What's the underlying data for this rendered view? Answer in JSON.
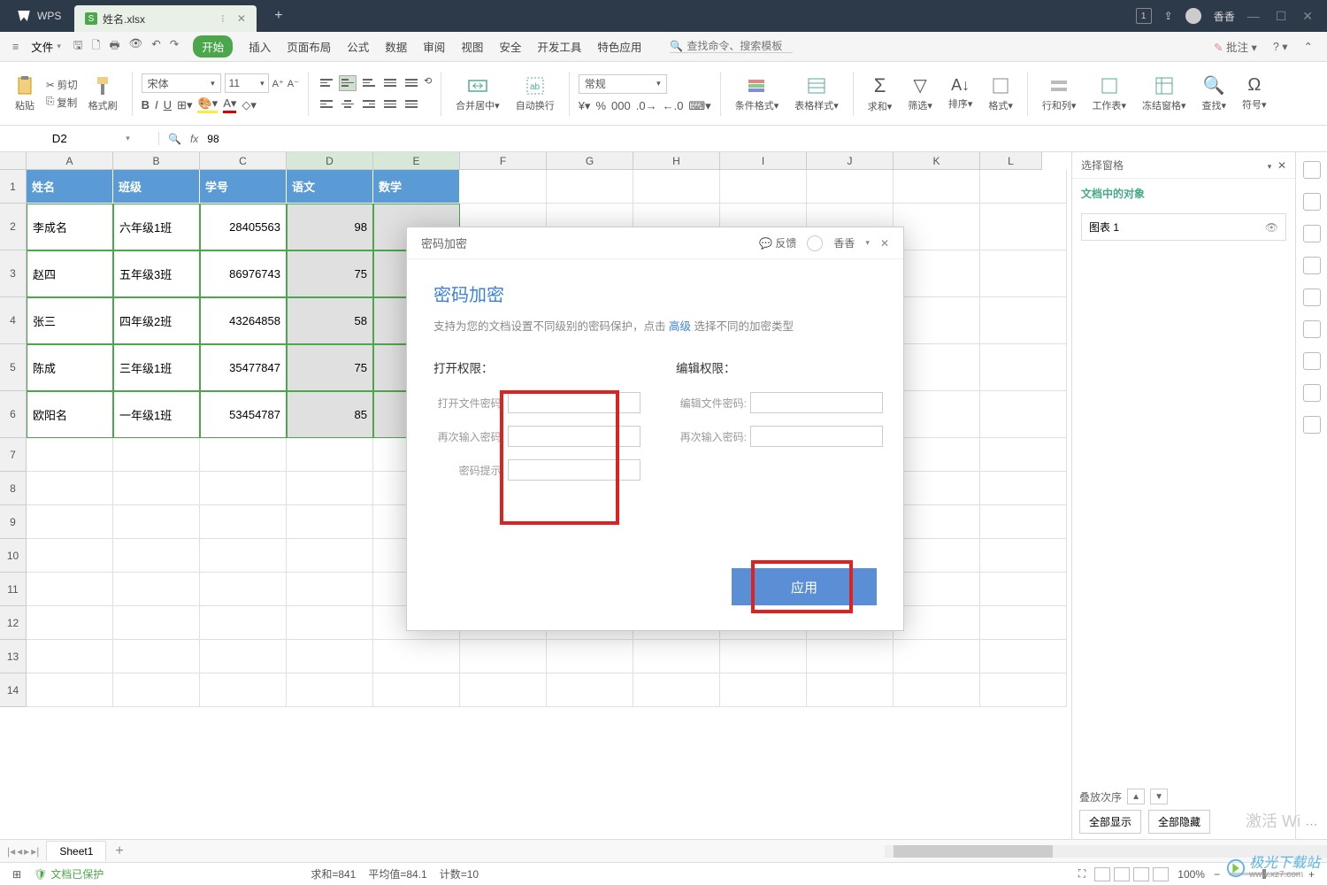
{
  "titlebar": {
    "app": "WPS",
    "filename": "姓名.xlsx",
    "user": "香香"
  },
  "menu": {
    "file": "文件",
    "tabs": [
      "开始",
      "插入",
      "页面布局",
      "公式",
      "数据",
      "审阅",
      "视图",
      "安全",
      "开发工具",
      "特色应用"
    ],
    "search_ph": "查找命令、搜索模板",
    "annotate": "批注"
  },
  "ribbon": {
    "paste": "粘贴",
    "cut": "剪切",
    "copy": "复制",
    "formatbrush": "格式刷",
    "font": "宋体",
    "size": "11",
    "merge": "合并居中",
    "wrap": "自动换行",
    "numfmt": "常规",
    "condfmt": "条件格式",
    "tablestyle": "表格样式",
    "sum": "求和",
    "filter": "筛选",
    "sort": "排序",
    "format": "格式",
    "rowcol": "行和列",
    "sheet": "工作表",
    "freeze": "冻结窗格",
    "find": "查找",
    "symbol": "符号"
  },
  "formula": {
    "cell": "D2",
    "value": "98"
  },
  "columns": [
    "A",
    "B",
    "C",
    "D",
    "E",
    "F",
    "G",
    "H",
    "I",
    "J",
    "K",
    "L"
  ],
  "table": {
    "headers": [
      "姓名",
      "班级",
      "学号",
      "语文",
      "数学"
    ],
    "rows": [
      [
        "李成名",
        "六年级1班",
        "28405563",
        "98",
        ""
      ],
      [
        "赵四",
        "五年级3班",
        "86976743",
        "75",
        ""
      ],
      [
        "张三",
        "四年级2班",
        "43264858",
        "58",
        ""
      ],
      [
        "陈成",
        "三年级1班",
        "35477847",
        "75",
        ""
      ],
      [
        "欧阳名",
        "一年级1班",
        "53454787",
        "85",
        ""
      ]
    ]
  },
  "sheettab": "Sheet1",
  "sidepanel": {
    "pane": "选择窗格",
    "doc_objs": "文档中的对象",
    "item": "图表 1",
    "stack": "叠放次序",
    "showall": "全部显示",
    "hideall": "全部隐藏"
  },
  "status": {
    "protected": "文档已保护",
    "sum": "求和=841",
    "avg": "平均值=84.1",
    "count": "计数=10",
    "zoom": "100%"
  },
  "dialog": {
    "title": "密码加密",
    "feedback": "反馈",
    "user": "香香",
    "heading": "密码加密",
    "sub_a": "支持为您的文档设置不同级别的密码保护，点击 ",
    "sub_link": "高级",
    "sub_b": " 选择不同的加密类型",
    "open_perm": "打开权限：",
    "edit_perm": "编辑权限：",
    "open_pwd": "打开文件密码:",
    "edit_pwd": "编辑文件密码:",
    "repeat": "再次输入密码:",
    "hint": "密码提示:",
    "apply": "应用"
  },
  "watermark": "极光下载站",
  "watermark_url": "www.xz7.com",
  "activate": "激活 Wi"
}
